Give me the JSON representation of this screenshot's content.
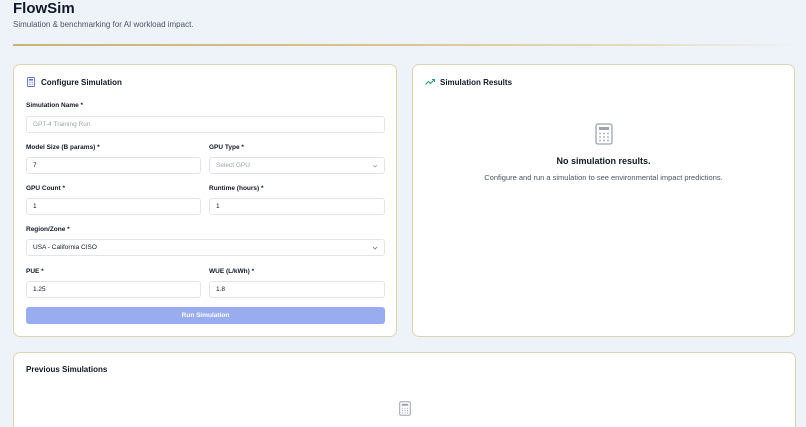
{
  "app": {
    "title": "FlowSim",
    "subtitle": "Simulation & benchmarking for AI workload impact."
  },
  "config": {
    "title": "Configure Simulation",
    "icon": "calculator-icon",
    "fields": {
      "simulation_name": {
        "label": "Simulation Name *",
        "value": "",
        "placeholder": "GPT-4 Training Run"
      },
      "model_size": {
        "label": "Model Size (B params) *",
        "value": "7"
      },
      "gpu_type": {
        "label": "GPU Type *",
        "value": "",
        "placeholder": "Select GPU"
      },
      "gpu_count": {
        "label": "GPU Count *",
        "value": "1"
      },
      "runtime": {
        "label": "Runtime (hours) *",
        "value": "1"
      },
      "region": {
        "label": "Region/Zone *",
        "value": "USA - California CISO"
      },
      "pue": {
        "label": "PUE *",
        "value": "1.25"
      },
      "wue": {
        "label": "WUE (L/kWh) *",
        "value": "1.8"
      }
    },
    "run_button": "Run Simulation"
  },
  "results": {
    "title": "Simulation Results",
    "icon": "trending-up-icon",
    "empty_title": "No simulation results.",
    "empty_desc": "Configure and run a simulation to see environmental impact predictions."
  },
  "previous": {
    "title": "Previous Simulations"
  },
  "colors": {
    "accent": "#98acef",
    "card_border": "#ddd3b0",
    "trend_green": "#22a06b",
    "background": "#eef3fa"
  }
}
